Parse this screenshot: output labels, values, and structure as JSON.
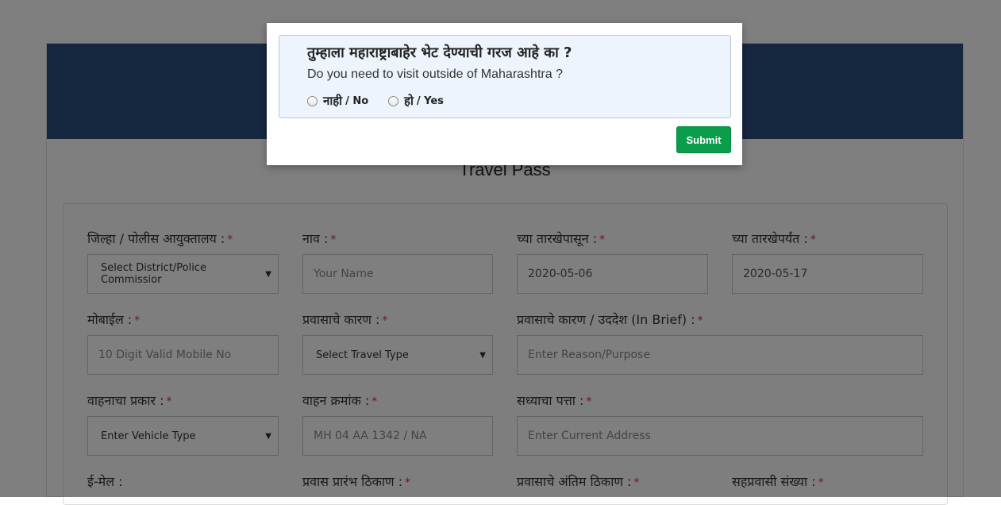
{
  "page": {
    "title": "Travel Pass"
  },
  "form": {
    "district": {
      "label": "जिल्हा / पोलीस आयुक्तालय :",
      "required": "*",
      "value": "Select District/Police Commissior"
    },
    "name": {
      "label": "नाव :",
      "required": "*",
      "placeholder": "Your Name"
    },
    "from_date": {
      "label": "च्या तारखेपासून :",
      "required": "*",
      "value": "2020-05-06"
    },
    "to_date": {
      "label": "च्या तारखेपर्यंत :",
      "required": "*",
      "value": "2020-05-17"
    },
    "mobile": {
      "label": "मोबाईल :",
      "required": "*",
      "placeholder": "10 Digit Valid Mobile No"
    },
    "travel_reason": {
      "label": "प्रवासाचे कारण :",
      "required": "*",
      "value": "Select Travel Type"
    },
    "purpose": {
      "label": "प्रवासाचे कारण / उददेश (In Brief) :",
      "required": "*",
      "placeholder": "Enter Reason/Purpose"
    },
    "vehicle_type": {
      "label": "वाहनाचा प्रकार :",
      "required": "*",
      "value": "Enter Vehicle Type"
    },
    "vehicle_number": {
      "label": "वाहन क्रमांक :",
      "required": "*",
      "placeholder": "MH 04 AA 1342 / NA"
    },
    "address": {
      "label": "सध्याचा पत्ता :",
      "required": "*",
      "placeholder": "Enter Current Address"
    },
    "email": {
      "label": "ई-मेल :"
    },
    "start_place": {
      "label": "प्रवास प्रारंभ ठिकाण :",
      "required": "*"
    },
    "end_place": {
      "label": "प्रवासाचे अंतिम ठिकाण :",
      "required": "*"
    },
    "co_passengers": {
      "label": "सहप्रवासी संख्या :",
      "required": "*"
    }
  },
  "modal": {
    "question_mr": "तुम्हाला महाराष्ट्राबाहेर भेट देण्याची गरज आहे का ?",
    "question_en": "Do you need to visit outside of Maharashtra ?",
    "options": [
      {
        "mr": "नाही",
        "en": "/ No"
      },
      {
        "mr": "हो",
        "en": "/ Yes"
      }
    ],
    "submit_label": "Submit"
  },
  "colors": {
    "header": "#2c4f80",
    "submit": "#0a9d4b",
    "required": "#d9302c",
    "question_bg": "#edf4fc"
  }
}
